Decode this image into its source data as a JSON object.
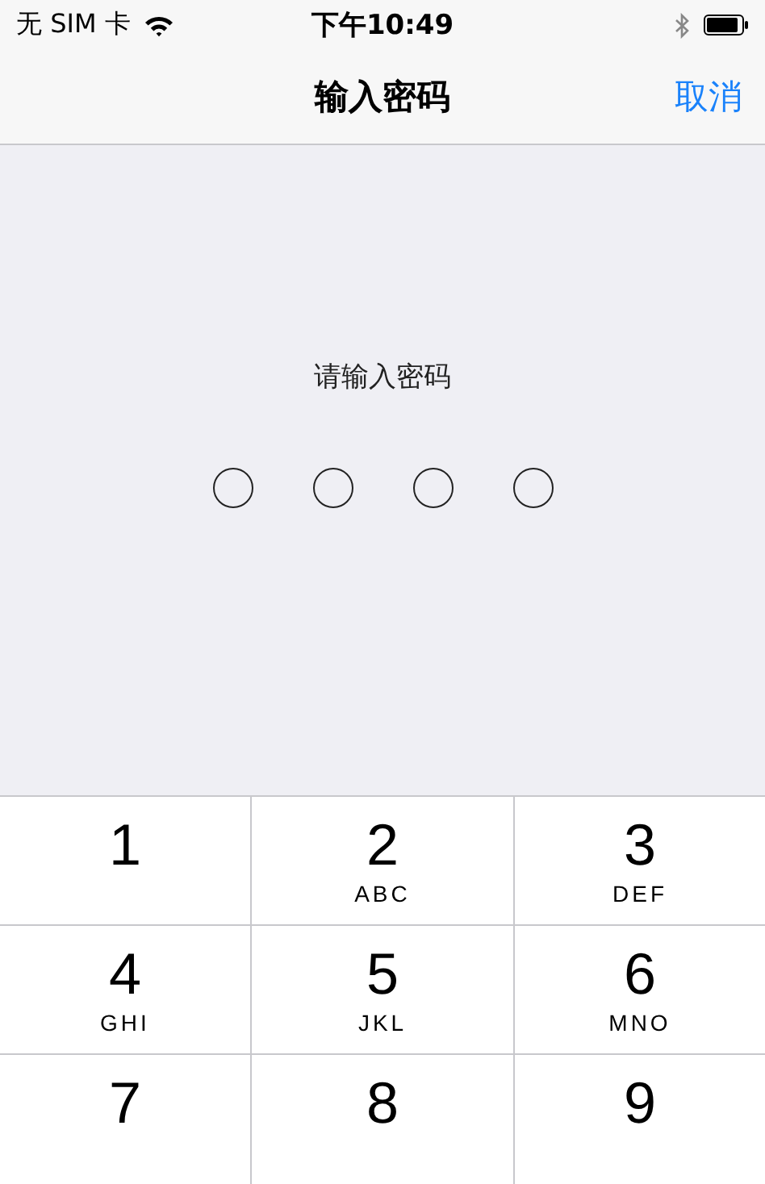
{
  "status_bar": {
    "carrier": "无 SIM 卡",
    "time": "下午10:49"
  },
  "nav": {
    "title": "输入密码",
    "cancel": "取消"
  },
  "prompt": "请输入密码",
  "passcode_dots": [
    {
      "filled": false
    },
    {
      "filled": false
    },
    {
      "filled": false
    },
    {
      "filled": false
    }
  ],
  "keypad": [
    {
      "digit": "1"
    },
    {
      "digit": "2",
      "letters": "ABC"
    },
    {
      "digit": "3",
      "letters": "DEF"
    },
    {
      "digit": "4",
      "letters": "GHI"
    },
    {
      "digit": "5",
      "letters": "JKL"
    },
    {
      "digit": "6",
      "letters": "MNO"
    },
    {
      "digit": "7"
    },
    {
      "digit": "8"
    },
    {
      "digit": "9"
    }
  ]
}
